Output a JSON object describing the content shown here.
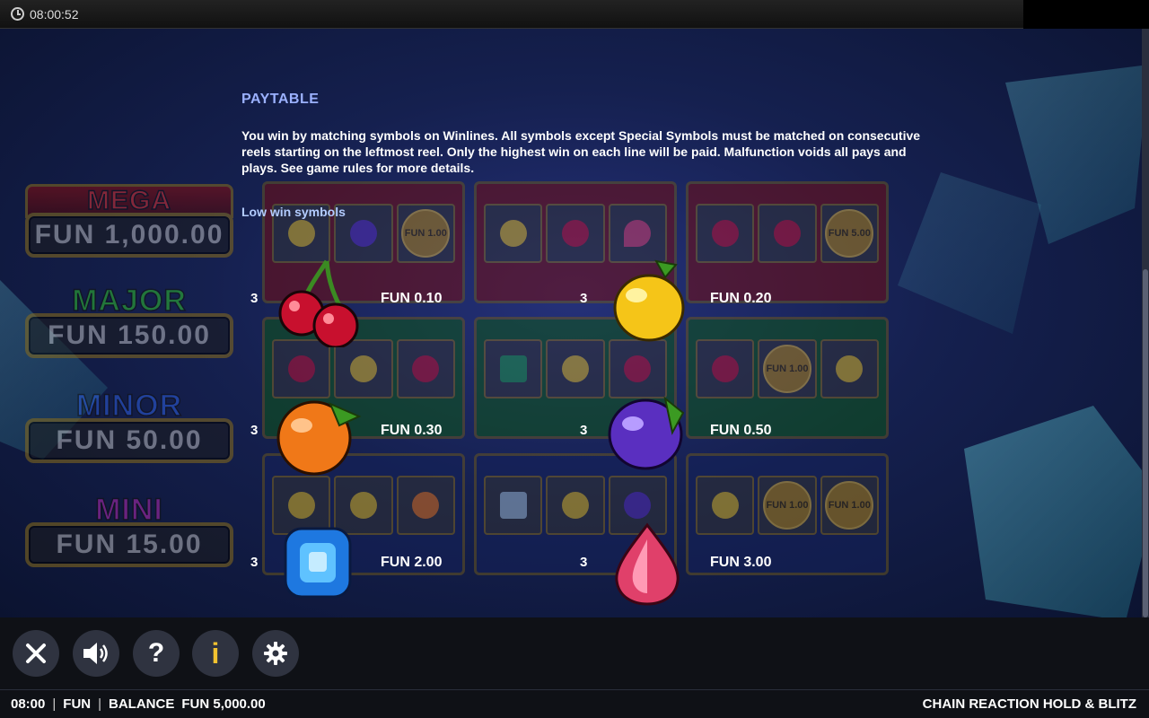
{
  "system": {
    "clock": "08:00:52"
  },
  "jackpots": [
    {
      "name": "MEGA",
      "value": "FUN 1,000.00"
    },
    {
      "name": "MAJOR",
      "value": "FUN 150.00"
    },
    {
      "name": "MINOR",
      "value": "FUN 50.00"
    },
    {
      "name": "MINI",
      "value": "FUN 15.00"
    }
  ],
  "background_panels": {
    "coin_labels": [
      "FUN 1.00",
      "FUN 5.00",
      "FUN 1.00",
      "FUN 1.00",
      "FUN 1.00"
    ]
  },
  "paytable": {
    "title": "PAYTABLE",
    "description": "You win by matching symbols on Winlines. All symbols except Special Symbols must be matched on consecutive reels starting on the leftmost reel. Only the highest win on each line will be paid. Malfunction voids all pays and plays. See game rules for more details.",
    "section": "Low win symbols",
    "symbols": [
      {
        "symbol": "cherry",
        "count": "3",
        "pay": "FUN 0.10"
      },
      {
        "symbol": "lemon",
        "count": "3",
        "pay": "FUN 0.20"
      },
      {
        "symbol": "orange",
        "count": "3",
        "pay": "FUN 0.30"
      },
      {
        "symbol": "plum",
        "count": "3",
        "pay": "FUN 0.50"
      },
      {
        "symbol": "blue-gem",
        "count": "3",
        "pay": "FUN 2.00"
      },
      {
        "symbol": "pink-gem",
        "count": "3",
        "pay": "FUN 3.00"
      }
    ]
  },
  "toolbar": {
    "buttons": [
      "close-icon",
      "sound-icon",
      "help-icon",
      "info-icon",
      "settings-icon"
    ],
    "help_label": "?",
    "info_label": "i"
  },
  "status": {
    "time": "08:00",
    "mode": "FUN",
    "balance_label": "BALANCE",
    "balance_value": "FUN 5,000.00",
    "game_title": "CHAIN REACTION HOLD & BLITZ"
  }
}
